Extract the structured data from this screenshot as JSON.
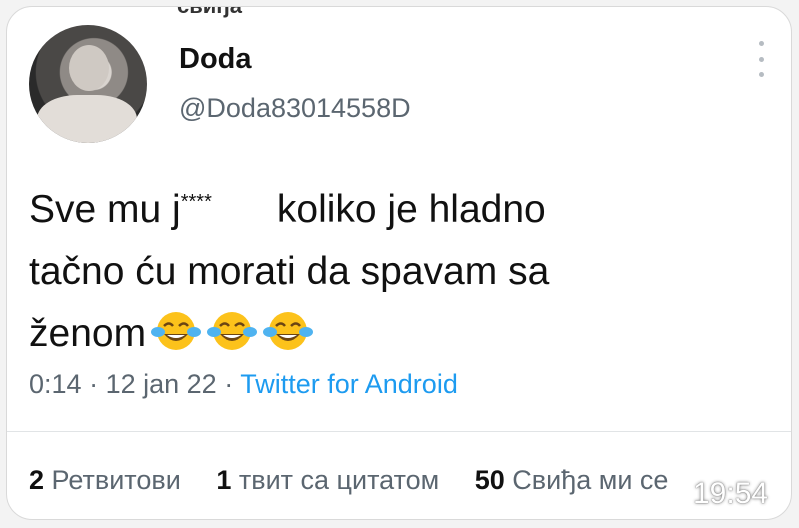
{
  "header": {
    "crop_text": "свиђа",
    "display_name": "Doda",
    "handle": "@Doda83014558D"
  },
  "tweet": {
    "line1_a": "Sve mu j",
    "line1_stars": "****",
    "line1_b": "koliko je hladno",
    "line2": "tačno ću morati da spavam sa",
    "line3": "ženom",
    "emoji": [
      "tears-of-joy-emoji",
      "tears-of-joy-emoji",
      "tears-of-joy-emoji"
    ]
  },
  "meta": {
    "time": "0:14",
    "separator": "·",
    "date": "12 jan 22",
    "source": "Twitter for Android"
  },
  "stats": {
    "retweets_count": "2",
    "retweets_label": "Ретвитови",
    "quotes_count": "1",
    "quotes_label": "твит са цитатом",
    "likes_count": "50",
    "likes_label": "Свиђа ми се"
  },
  "overlay": {
    "clock": "19:54"
  },
  "colors": {
    "link": "#1d9bf0",
    "secondary_text": "#5b6670"
  }
}
